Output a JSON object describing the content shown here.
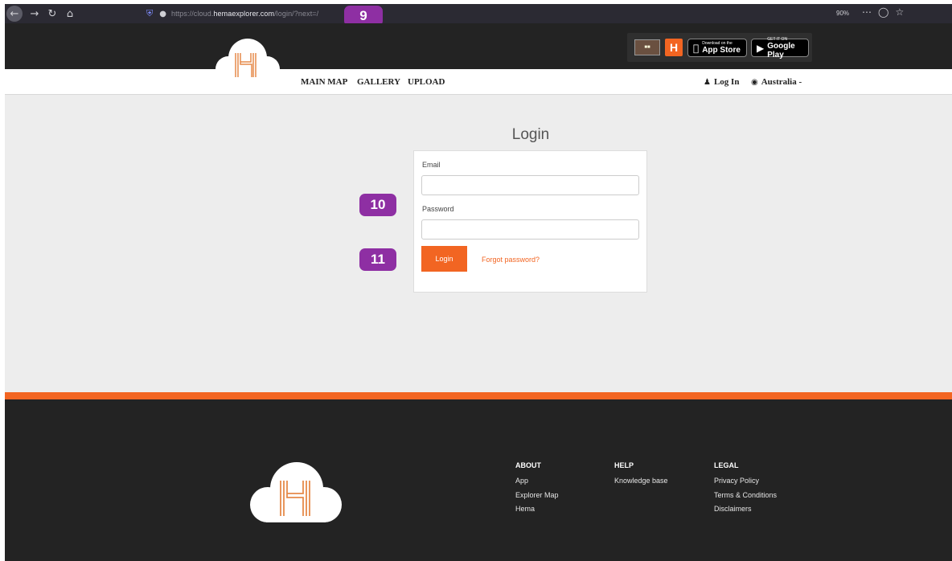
{
  "browser": {
    "url_prefix": "https://cloud.",
    "url_host": "hemaexplorer.com",
    "url_path": "/login/?next=/",
    "zoom": "90%"
  },
  "steps": {
    "nine": "9",
    "ten": "10",
    "eleven": "11"
  },
  "header": {
    "badge_h": "H",
    "app_store_small": "Download on the",
    "app_store_big": "App Store",
    "google_play_small": "GET IT ON",
    "google_play_big": "Google Play",
    "nav": [
      "MAIN MAP",
      "GALLERY",
      "UPLOAD"
    ],
    "login_label": "Log In",
    "region_label": "Australia -"
  },
  "login": {
    "title": "Login",
    "email_label": "Email",
    "password_label": "Password",
    "button_label": "Login",
    "forgot_label": "Forgot password?"
  },
  "footer": {
    "columns": [
      {
        "heading": "ABOUT",
        "links": [
          "App",
          "Explorer Map",
          "Hema"
        ]
      },
      {
        "heading": "HELP",
        "links": [
          "Knowledge base"
        ]
      },
      {
        "heading": "LEGAL",
        "links": [
          "Privacy Policy",
          "Terms & Conditions",
          "Disclaimers"
        ]
      }
    ]
  },
  "colors": {
    "brand_orange": "#f26522",
    "dark": "#232323",
    "badge_purple": "#8e2fa3"
  }
}
